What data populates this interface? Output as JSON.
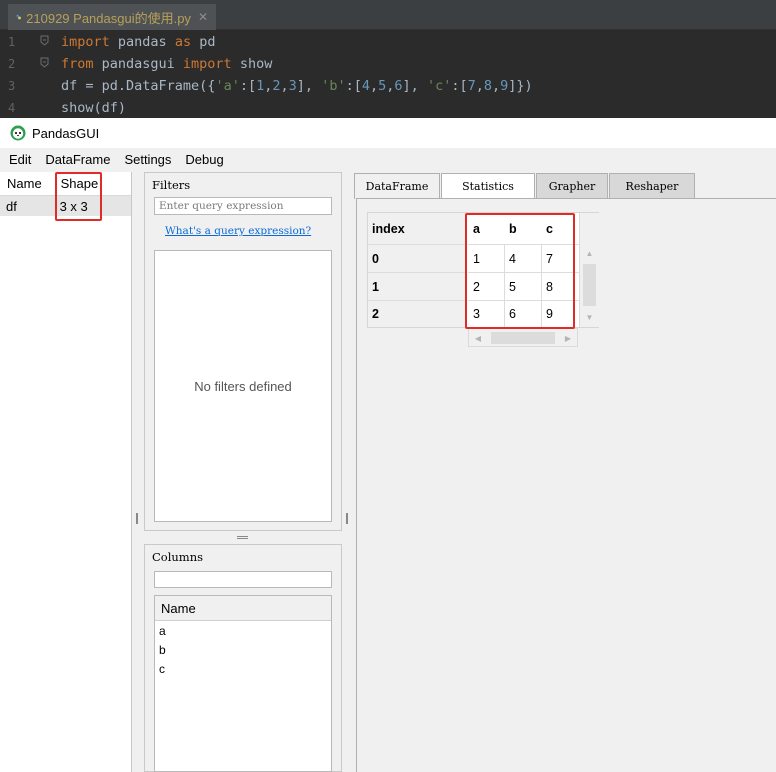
{
  "ide": {
    "tab_name": "210929 Pandasgui的使用.py",
    "tab_close": "✕",
    "lines": [
      {
        "number": "1",
        "parts": [
          {
            "t": "import",
            "c": "kw"
          },
          {
            "t": " pandas ",
            "c": "code"
          },
          {
            "t": "as",
            "c": "kw"
          },
          {
            "t": " pd",
            "c": "code"
          }
        ]
      },
      {
        "number": "2",
        "parts": [
          {
            "t": "from",
            "c": "kw"
          },
          {
            "t": " pandasgui ",
            "c": "code"
          },
          {
            "t": "import",
            "c": "kw"
          },
          {
            "t": " show",
            "c": "code"
          }
        ]
      },
      {
        "number": "3",
        "parts": [
          {
            "t": "df = pd.DataFrame({",
            "c": "code"
          },
          {
            "t": "'a'",
            "c": "str"
          },
          {
            "t": ":[",
            "c": "code"
          },
          {
            "t": "1",
            "c": "num"
          },
          {
            "t": ",",
            "c": "code"
          },
          {
            "t": "2",
            "c": "num"
          },
          {
            "t": ",",
            "c": "code"
          },
          {
            "t": "3",
            "c": "num"
          },
          {
            "t": "], ",
            "c": "code"
          },
          {
            "t": "'b'",
            "c": "str"
          },
          {
            "t": ":[",
            "c": "code"
          },
          {
            "t": "4",
            "c": "num"
          },
          {
            "t": ",",
            "c": "code"
          },
          {
            "t": "5",
            "c": "num"
          },
          {
            "t": ",",
            "c": "code"
          },
          {
            "t": "6",
            "c": "num"
          },
          {
            "t": "], ",
            "c": "code"
          },
          {
            "t": "'c'",
            "c": "str"
          },
          {
            "t": ":[",
            "c": "code"
          },
          {
            "t": "7",
            "c": "num"
          },
          {
            "t": ",",
            "c": "code"
          },
          {
            "t": "8",
            "c": "num"
          },
          {
            "t": ",",
            "c": "code"
          },
          {
            "t": "9",
            "c": "num"
          },
          {
            "t": "]})",
            "c": "code"
          }
        ]
      },
      {
        "number": "4",
        "parts": [
          {
            "t": "show(df)",
            "c": "code"
          }
        ]
      }
    ]
  },
  "window": {
    "title": "PandasGUI"
  },
  "menu": [
    "Edit",
    "DataFrame",
    "Settings",
    "Debug"
  ],
  "df_list": {
    "headers": {
      "name": "Name",
      "shape": "Shape"
    },
    "rows": [
      {
        "name": "df",
        "shape": "3 x 3"
      }
    ]
  },
  "filters": {
    "title": "Filters",
    "query_placeholder": "Enter query expression",
    "link_text": "What's a query expression?",
    "empty_text": "No filters defined"
  },
  "columns_panel": {
    "title": "Columns",
    "header": "Name",
    "items": [
      "a",
      "b",
      "c"
    ]
  },
  "tabs": [
    "DataFrame",
    "Statistics",
    "Grapher",
    "Reshaper"
  ],
  "table": {
    "index_header": "index",
    "columns": [
      "a",
      "b",
      "c"
    ],
    "index": [
      "0",
      "1",
      "2"
    ],
    "rows": [
      [
        "1",
        "4",
        "7"
      ],
      [
        "2",
        "5",
        "8"
      ],
      [
        "3",
        "6",
        "9"
      ]
    ]
  },
  "colors": {
    "highlight": "#e12b26",
    "link": "#0b6bd6",
    "ide_background": "#2b2b2b"
  }
}
